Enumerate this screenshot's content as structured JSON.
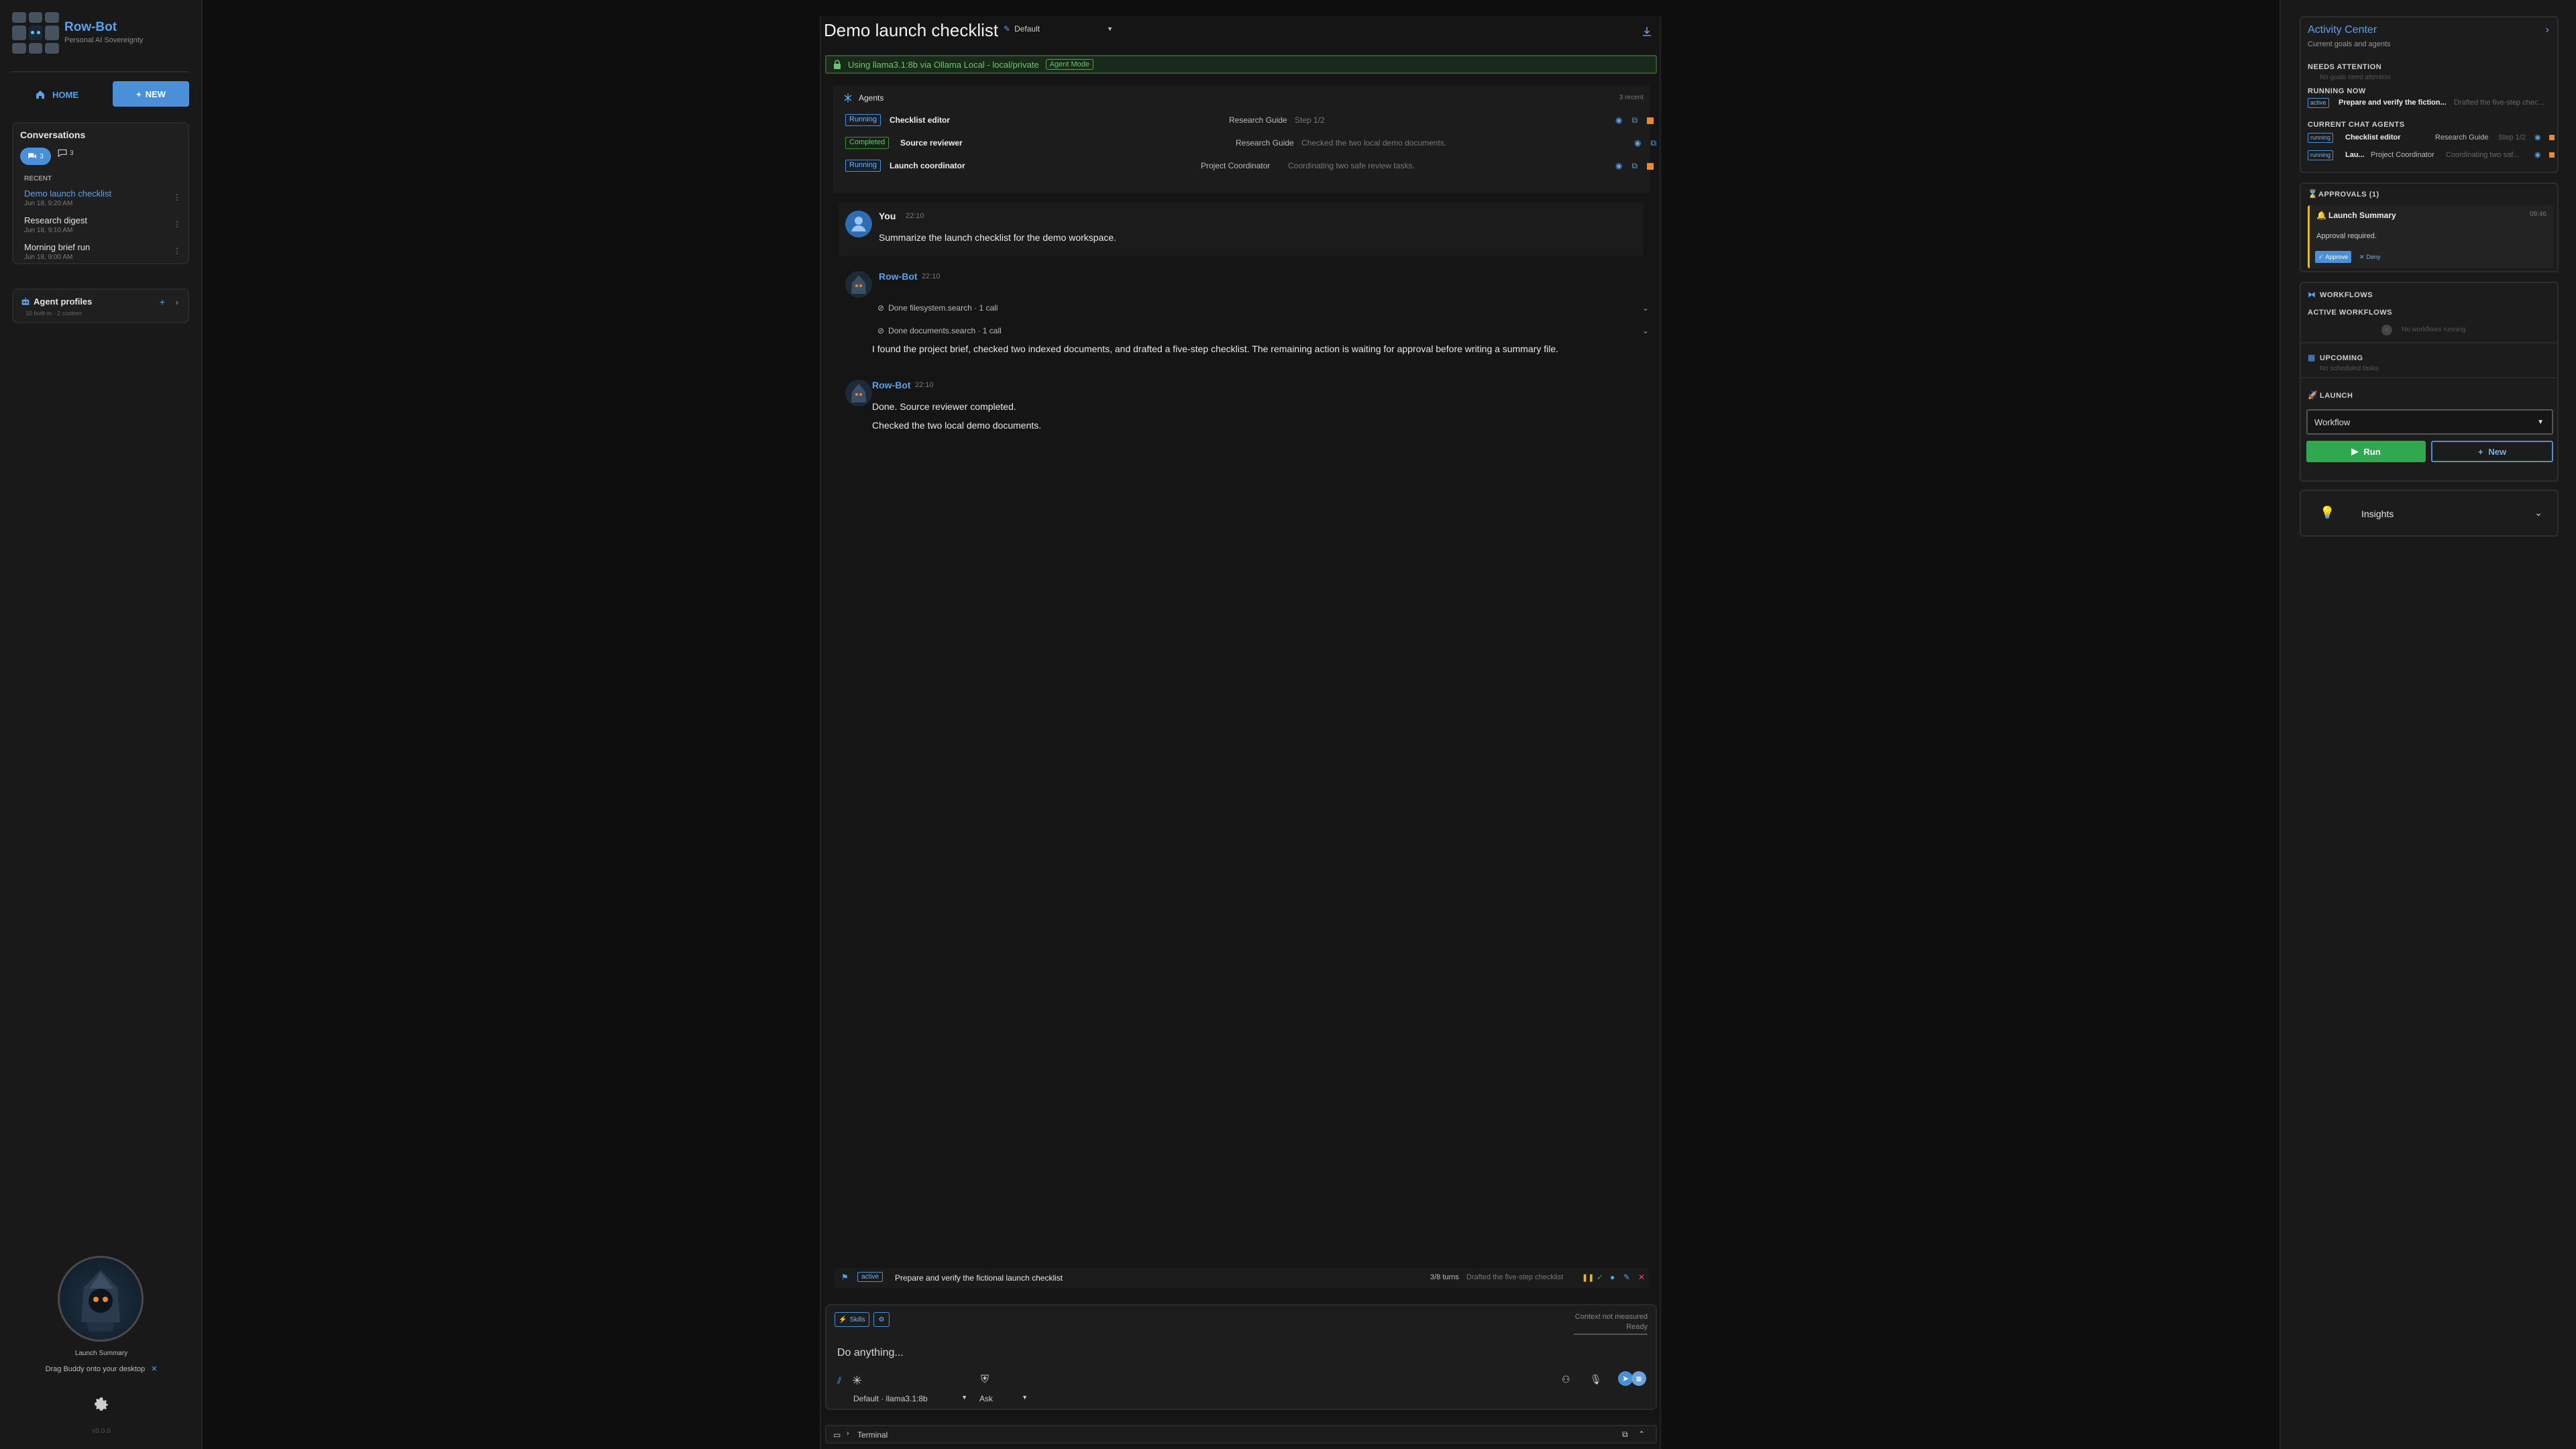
{
  "app": {
    "name": "Row-Bot",
    "tagline": "Personal AI Sovereignty",
    "version": "v0.0.0"
  },
  "sidebar": {
    "home_label": "HOME",
    "new_label": "NEW",
    "conversations_title": "Conversations",
    "tab_active_count": "3",
    "tab_other_count": "3",
    "recent_label": "RECENT",
    "items": [
      {
        "title": "Demo launch checklist",
        "date": "Jun 18, 9:20 AM"
      },
      {
        "title": "Research digest",
        "date": "Jun 18, 9:10 AM"
      },
      {
        "title": "Morning brief run",
        "date": "Jun 18, 9:00 AM"
      }
    ],
    "profiles_title": "Agent profiles",
    "profiles_sub": "10 built-in · 2 custom",
    "buddy_label": "Launch Summary",
    "drag_text": "Drag Buddy onto your desktop"
  },
  "chat": {
    "title": "Demo launch checklist",
    "persona": "Default",
    "banner": "Using llama3.1:8b via Ollama Local - local/private",
    "agent_mode": "Agent Mode",
    "agents_label": "Agents",
    "agents_recent": "3 recent",
    "agents": [
      {
        "status": "Running",
        "name": "Checklist editor",
        "profile": "Research Guide",
        "note": "Step 1/2",
        "icons": 3
      },
      {
        "status": "Completed",
        "name": "Source reviewer",
        "profile": "Research Guide",
        "note": "Checked the two local demo documents.",
        "icons": 2
      },
      {
        "status": "Running",
        "name": "Launch coordinator",
        "profile": "Project Coordinator",
        "note": "Coordinating two safe review tasks.",
        "icons": 3
      }
    ],
    "messages": {
      "user": {
        "name": "You",
        "time": "22:10",
        "text": "Summarize the launch checklist for the demo workspace."
      },
      "bot1": {
        "name": "Row-Bot",
        "time": "22:10",
        "tool1": "Done filesystem.search · 1 call",
        "tool2": "Done documents.search · 1 call",
        "text": "I found the project brief, checked two indexed documents, and drafted a five-step checklist. The remaining action is waiting for approval before writing a summary file."
      },
      "bot2": {
        "name": "Row-Bot",
        "time": "22:10",
        "line1": "Done. Source reviewer completed.",
        "line2": "Checked the two local demo documents."
      }
    },
    "goal": {
      "status": "active",
      "text": "Prepare and verify the fictional launch checklist",
      "turns": "3/8 turns",
      "note": "Drafted the five-step checklist"
    },
    "composer": {
      "skills_label": "Skills",
      "context_line1": "Context not measured",
      "context_line2": "Ready",
      "placeholder": "Do anything...",
      "model": "Default · llama3.1:8b",
      "mode": "Ask"
    },
    "terminal_label": "Terminal"
  },
  "activity": {
    "title": "Activity Center",
    "subtitle": "Current goals and agents",
    "needs_attention": "NEEDS ATTENTION",
    "needs_none": "No goals need attention",
    "running_now": "RUNNING NOW",
    "running": [
      {
        "tag": "active",
        "title": "Prepare and verify the fiction...",
        "note": "Drafted the five-step chec..."
      }
    ],
    "current_agents_label": "CURRENT CHAT AGENTS",
    "current_agents": [
      {
        "tag": "running",
        "name": "Checklist editor",
        "profile": "Research Guide",
        "note": "Step 1/2"
      },
      {
        "tag": "running",
        "name": "Lau...",
        "profile": "Project Coordinator",
        "note": "Coordinating two saf..."
      }
    ],
    "approvals_label": "APPROVALS (1)",
    "approval": {
      "title": "Launch Summary",
      "time": "09:46",
      "text": "Approval required.",
      "approve": "Approve",
      "deny": "Deny"
    },
    "workflows_label": "WORKFLOWS",
    "active_workflows": "ACTIVE WORKFLOWS",
    "no_workflows": "No workflows running",
    "upcoming_label": "UPCOMING",
    "no_upcoming": "No scheduled tasks",
    "launch_label": "LAUNCH",
    "workflow_select": "Workflow",
    "run_label": "Run",
    "new_label": "New",
    "insights_label": "Insights"
  },
  "colors": {
    "accent": "#4a90d9",
    "success": "#2fa84f",
    "warn": "#e98a2e",
    "danger": "#d9534f"
  }
}
